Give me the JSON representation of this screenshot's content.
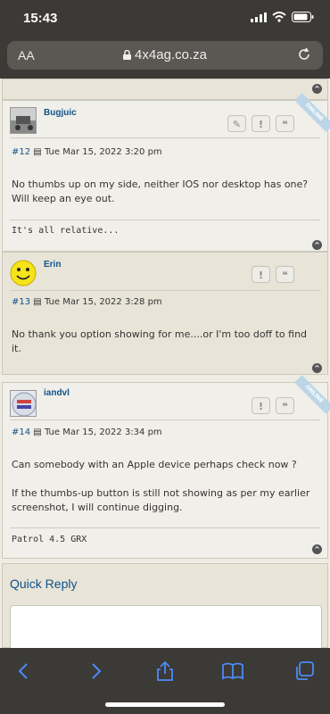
{
  "status_bar": {
    "time": "15:43"
  },
  "url_bar": {
    "aa_label": "AA",
    "host": "4x4ag.co.za"
  },
  "posts": [
    {
      "author": "Bugjuic",
      "number": "#12",
      "date": "Tue Mar 15, 2022 3:20 pm",
      "badge": "ONLINE",
      "body": "No thumbs up on my side, neither IOS nor desktop has one? Will keep an eye out.",
      "signature": "It's all relative..."
    },
    {
      "author": "Erin",
      "number": "#13",
      "date": "Tue Mar 15, 2022 3:28 pm",
      "body": "No thank you option showing for me....or I'm too doff to find it."
    },
    {
      "author": "iandvl",
      "number": "#14",
      "date": "Tue Mar 15, 2022 3:34 pm",
      "badge": "ONLINE",
      "body_1": "Can somebody with an Apple device perhaps check now ?",
      "body_2": "If the thumbs-up button is still not showing as per my earlier screenshot, I will continue digging.",
      "signature": "Patrol 4.5 GRX"
    }
  ],
  "quick_reply": {
    "title": "Quick Reply"
  },
  "buttons": {
    "edit": "✎",
    "report": "!",
    "quote": "❝"
  }
}
